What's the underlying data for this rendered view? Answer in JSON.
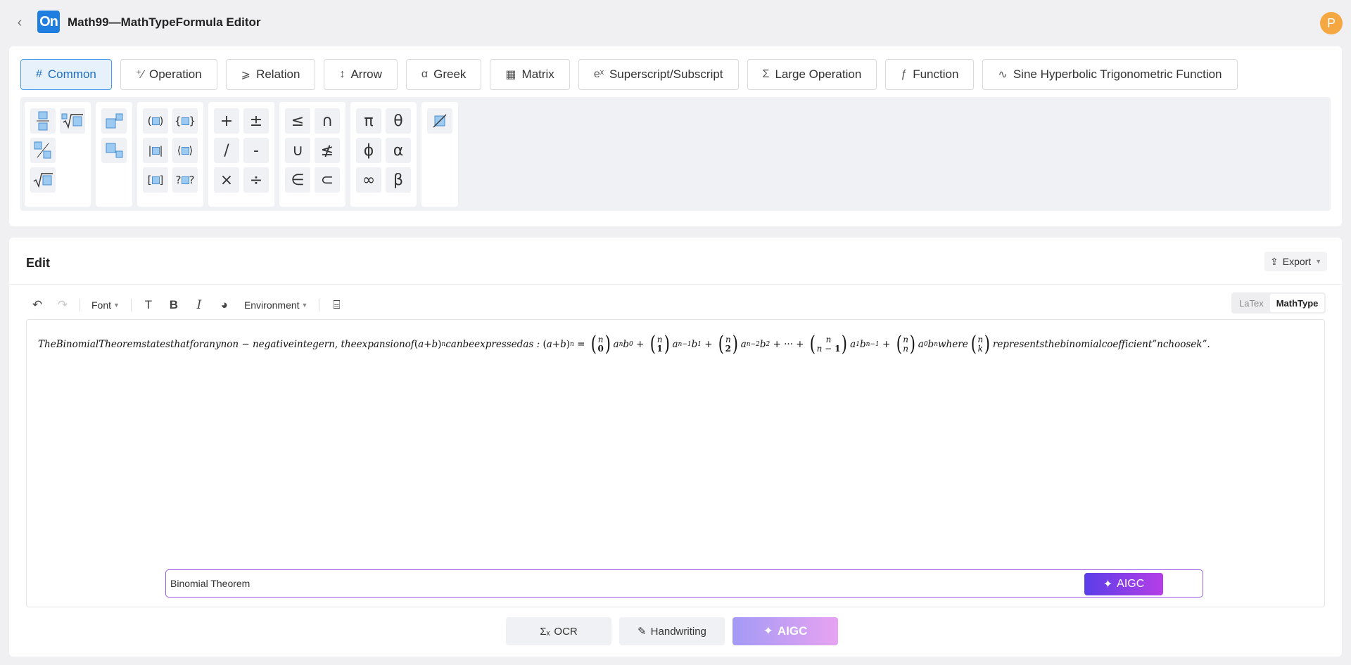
{
  "header": {
    "logo_text": "On",
    "title": "Math99—MathTypeFormula Editor",
    "avatar_letter": "P"
  },
  "tabs": [
    {
      "icon": "#",
      "label": "Common"
    },
    {
      "icon": "⁺⁄",
      "label": "Operation"
    },
    {
      "icon": "⩾",
      "label": "Relation"
    },
    {
      "icon": "↕",
      "label": "Arrow"
    },
    {
      "icon": "α",
      "label": "Greek"
    },
    {
      "icon": "▦",
      "label": "Matrix"
    },
    {
      "icon": "eˣ",
      "label": "Superscript/Subscript"
    },
    {
      "icon": "Σ",
      "label": "Large Operation"
    },
    {
      "icon": "ƒ",
      "label": "Function"
    },
    {
      "icon": "∿",
      "label": "Sine Hyperbolic Trigonometric Function"
    }
  ],
  "symbols": {
    "operators": [
      "+",
      "/",
      "×",
      "±",
      "-",
      "÷"
    ],
    "relations": [
      "≤",
      "∪",
      "∈",
      "∩",
      "≰",
      "⊂"
    ],
    "greek": [
      "π",
      "ϕ",
      "∞",
      "θ",
      "α",
      "β"
    ]
  },
  "edit": {
    "title": "Edit",
    "export_label": "Export",
    "font_label": "Font",
    "environment_label": "Environment",
    "mode_latex": "LaTex",
    "mode_mathtype": "MathType"
  },
  "formula": {
    "text_part1": "TheBinomialTheoremstatesthatforanynon − negativeintegern, theexpansionof",
    "text_part2": "canbeexpressedas :",
    "text_part3": "where",
    "text_part4": "representsthebinomialcoefficient”nchoosek”."
  },
  "aigc": {
    "input_value": "Binomial Theorem",
    "send_label": "AIGC"
  },
  "bottom": {
    "ocr_label": "OCR",
    "handwriting_label": "Handwriting",
    "aigc_label": "AIGC"
  }
}
